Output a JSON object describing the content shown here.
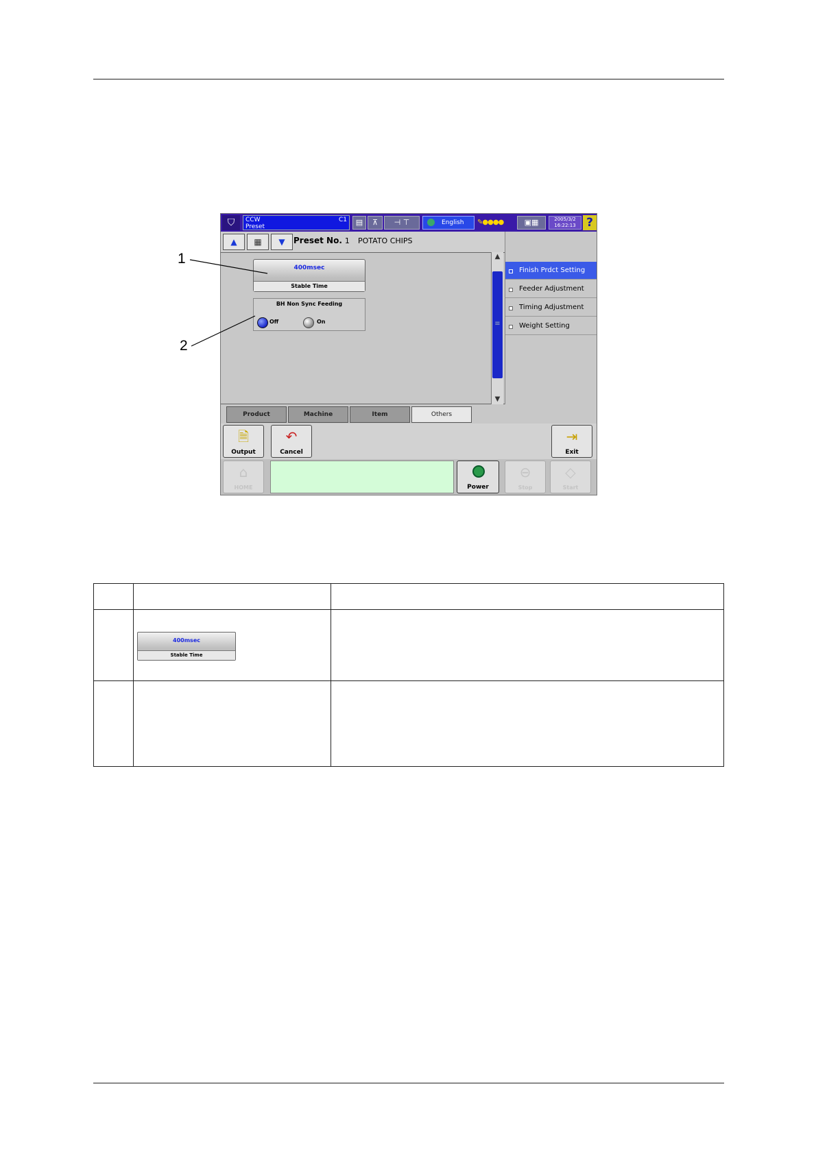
{
  "screen": {
    "topbar": {
      "title_line1": "CCW",
      "title_line2": "Preset",
      "code": "C1",
      "language": "English",
      "date": "2005/3/2",
      "time": "16:22:13",
      "help": "?"
    },
    "preset_label": "Preset No.",
    "preset_number": "1",
    "product_name": "POTATO CHIPS",
    "stable_time": {
      "value": "400msec",
      "label": "Stable Time"
    },
    "bh_non_sync": {
      "title": "BH Non Sync Feeding",
      "off": "Off",
      "on": "On",
      "selected": "Off"
    },
    "side_menu": [
      {
        "label": "Finish Prdct Setting",
        "active": true
      },
      {
        "label": "Feeder Adjustment",
        "active": false
      },
      {
        "label": "Timing Adjustment",
        "active": false
      },
      {
        "label": "Weight Setting",
        "active": false
      }
    ],
    "tabs": [
      {
        "label": "Product",
        "active": false
      },
      {
        "label": "Machine",
        "active": false
      },
      {
        "label": "Item",
        "active": false
      },
      {
        "label": "Others",
        "active": true
      }
    ],
    "actions": {
      "output": "Output",
      "cancel": "Cancel",
      "exit": "Exit"
    },
    "bottom": {
      "home": "HOME",
      "power": "Power",
      "stop": "Stop",
      "start": "Start"
    }
  },
  "callouts": [
    "1",
    "2"
  ],
  "table": {
    "rows": [
      {
        "number": "",
        "image_value": "400msec",
        "image_label": "Stable Time"
      }
    ]
  },
  "colors": {
    "topbar": "#3a1aa8",
    "accent_blue": "#1a28e0",
    "message_bg": "#d4fcd8",
    "side_active": "#3a5ae8"
  }
}
